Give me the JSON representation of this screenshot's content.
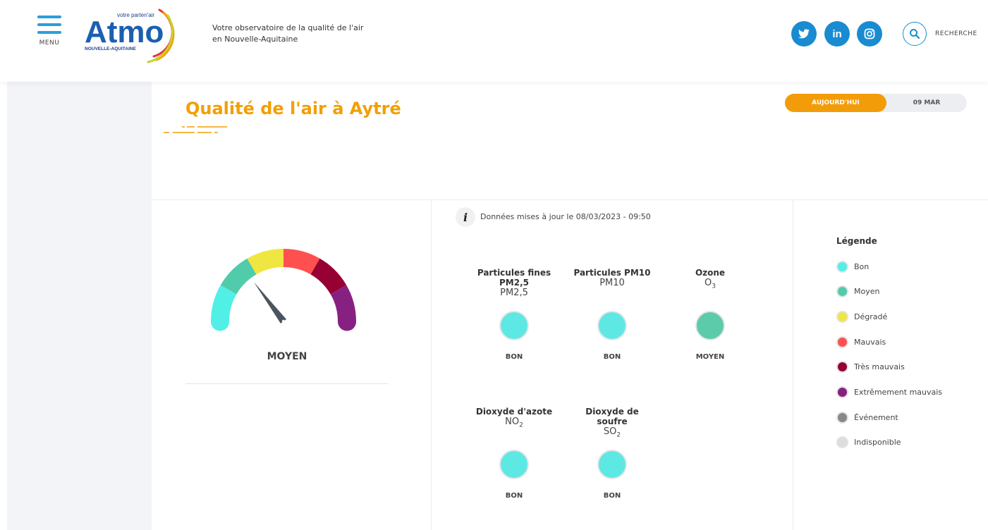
{
  "header": {
    "menu_label": "MENU",
    "logo": {
      "tagline": "votre parten'air",
      "name": "Atmo",
      "region": "NOUVELLE-AQUITAINE"
    },
    "tagline_line1": "Votre observatoire de la qualité de l'air",
    "tagline_line2": "en Nouvelle-Aquitaine",
    "social": [
      {
        "name": "twitter",
        "glyph": "t"
      },
      {
        "name": "linkedin",
        "glyph": "in"
      },
      {
        "name": "instagram",
        "glyph": "◎"
      }
    ],
    "search_label": "RECHERCHE",
    "accent_color": "#1a8bd0"
  },
  "page": {
    "title": "Qualité de l'air à Aytré",
    "title_color": "#f29f05",
    "date_toggle": {
      "today": "AUJOURD'HUI",
      "other": "09 MAR"
    }
  },
  "gauge": {
    "label": "MOYEN",
    "level_index": 2,
    "levels": 6
  },
  "update": {
    "info_glyph": "i",
    "text": "Données mises à jour le 08/03/2023 - 09:50"
  },
  "pollutants": [
    {
      "name_line1": "Particules fines",
      "name_line2": "PM2,5",
      "code": "PM2,5",
      "code_sub": "",
      "status": "BON",
      "color": "#5ee8e4"
    },
    {
      "name_line1": "Particules PM10",
      "name_line2": "",
      "code": "PM10",
      "code_sub": "",
      "status": "BON",
      "color": "#5ee8e4"
    },
    {
      "name_line1": "Ozone",
      "name_line2": "",
      "code": "O",
      "code_sub": "3",
      "status": "MOYEN",
      "color": "#5ccbaa"
    },
    {
      "name_line1": "Dioxyde d'azote",
      "name_line2": "",
      "code": "NO",
      "code_sub": "2",
      "status": "BON",
      "color": "#5ee8e4"
    },
    {
      "name_line1": "Dioxyde de",
      "name_line2": "soufre",
      "code": "SO",
      "code_sub": "2",
      "status": "BON",
      "color": "#5ee8e4"
    }
  ],
  "legend": {
    "title": "Légende",
    "items": [
      {
        "label": "Bon",
        "color": "#50f0e6"
      },
      {
        "label": "Moyen",
        "color": "#50ccaa"
      },
      {
        "label": "Dégradé",
        "color": "#f0e641"
      },
      {
        "label": "Mauvais",
        "color": "#ff5050"
      },
      {
        "label": "Très mauvais",
        "color": "#960032"
      },
      {
        "label": "Extrêmement mauvais",
        "color": "#872181"
      },
      {
        "label": "Événement",
        "color": "#888888"
      },
      {
        "label": "Indisponible",
        "color": "#dddddd"
      }
    ]
  }
}
